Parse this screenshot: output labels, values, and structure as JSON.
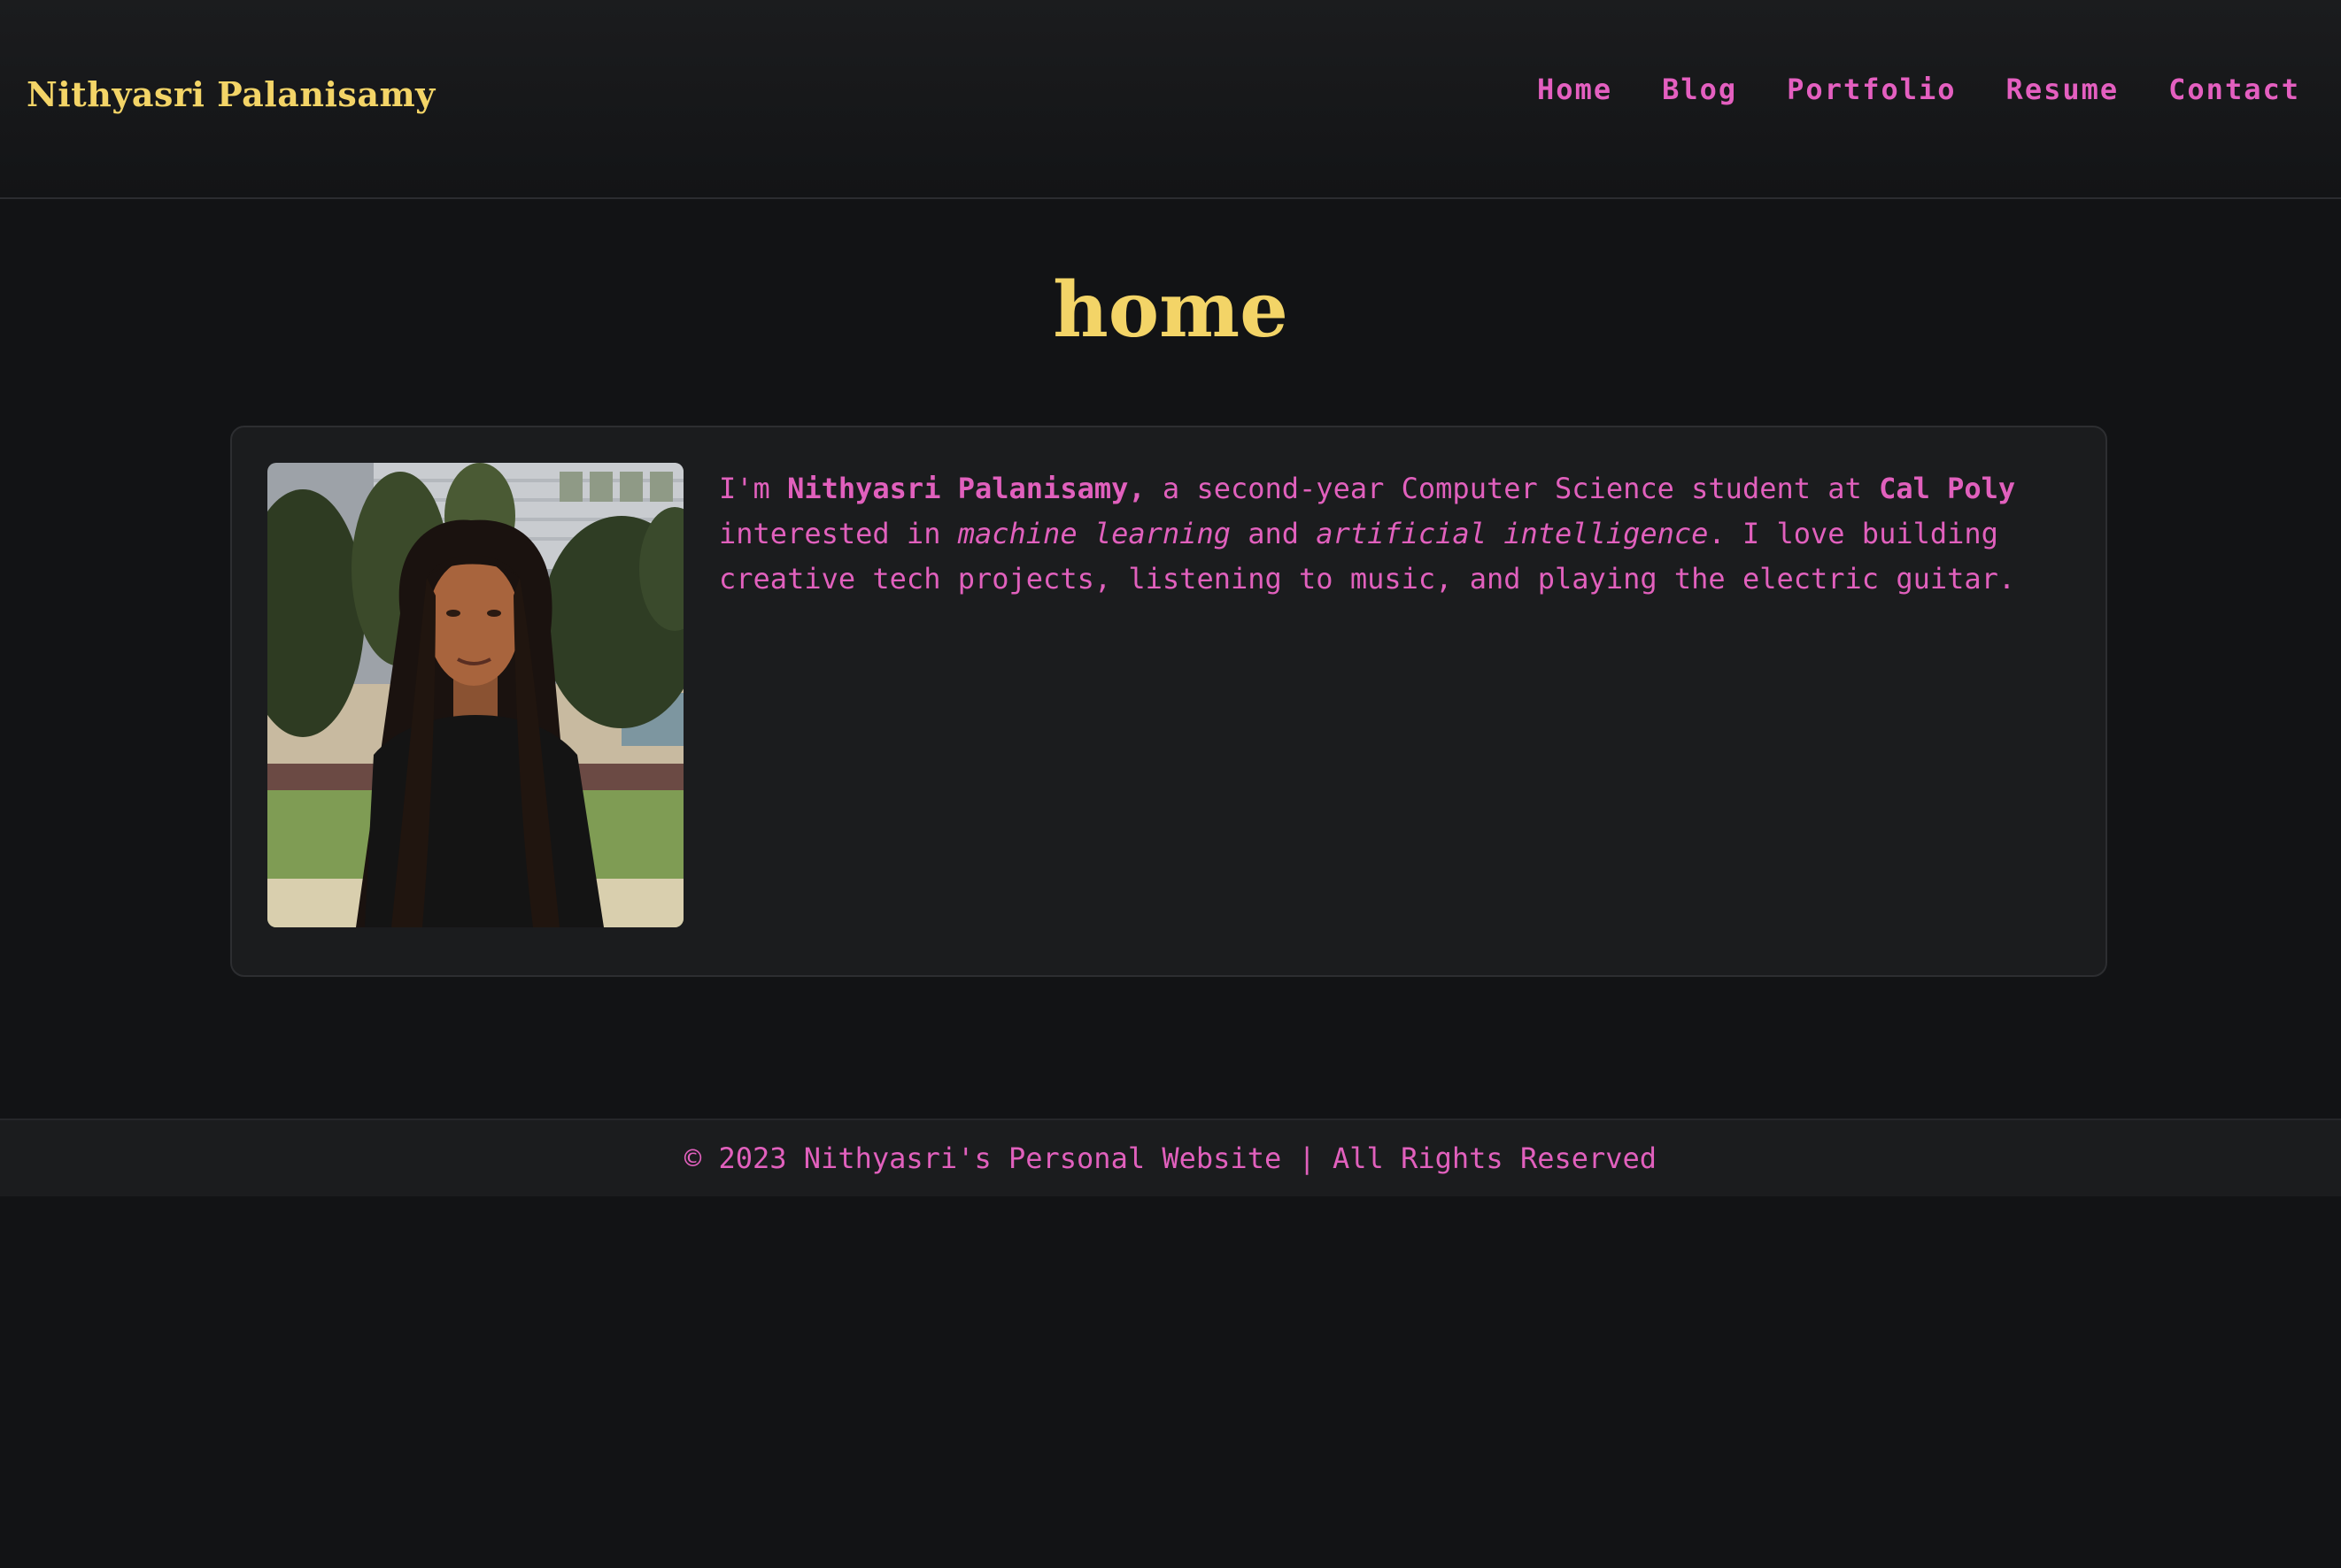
{
  "header": {
    "site_title": "Nithyasri Palanisamy",
    "nav": [
      {
        "label": "Home"
      },
      {
        "label": "Blog"
      },
      {
        "label": "Portfolio"
      },
      {
        "label": "Resume"
      },
      {
        "label": "Contact"
      }
    ]
  },
  "main": {
    "heading": "home",
    "intro": {
      "t1": "I'm ",
      "name": "Nithyasri Palanisamy,",
      "t2": " a second-year Computer Science student at ",
      "school": "Cal Poly",
      "t3": " interested in ",
      "ml": "machine learning",
      "t4": " and ",
      "ai": "artificial intelligence",
      "t5": ". I love building creative tech projects, listening to music, and playing the electric guitar."
    },
    "photo_alt": "Nithyasri Palanisamy"
  },
  "footer": {
    "text": "© 2023 Nithyasri's Personal Website | All Rights Reserved"
  },
  "colors": {
    "background": "#121315",
    "accent_yellow": "#f3d467",
    "accent_pink": "#e45fc0",
    "card": "#1b1c1e"
  }
}
